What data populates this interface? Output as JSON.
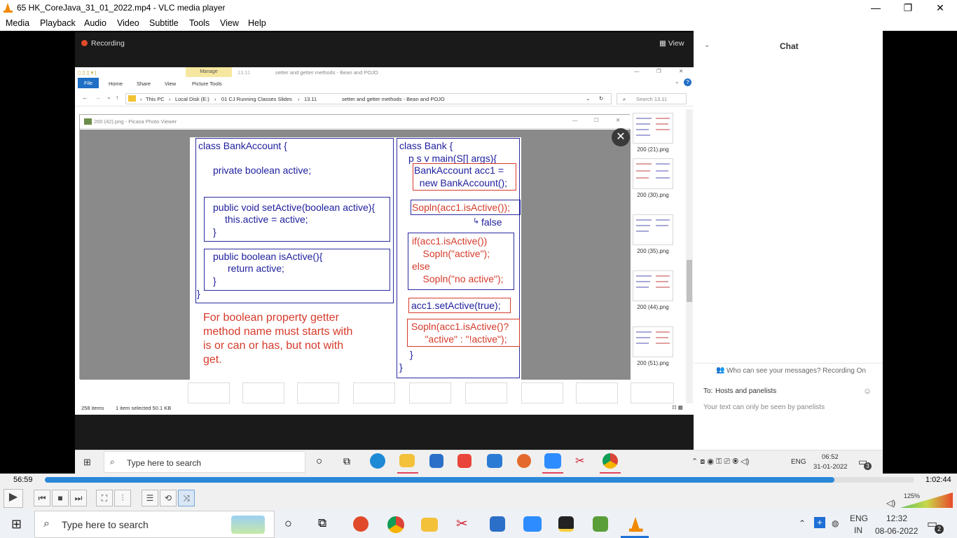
{
  "window": {
    "title": "65 HK_CoreJava_31_01_2022.mp4 - VLC media player"
  },
  "menus": [
    "Media",
    "Playback",
    "Audio",
    "Video",
    "Subtitle",
    "Tools",
    "View",
    "Help"
  ],
  "zoom": {
    "recording": "Recording",
    "view": "View"
  },
  "explorer": {
    "quick_access": "▯ ▯ ▯ ▾ |",
    "manage_tab": "Manage",
    "window_title": "13.11",
    "title_path": "setter and getter methods - Bean and POJO",
    "tabs": [
      "File",
      "Home",
      "Share",
      "View",
      "Picture Tools"
    ],
    "address": [
      "This PC",
      "Local Disk (E:)",
      "01 CJ Running Classes Slides",
      "13.11",
      "setter and getter methods - Bean and POJO"
    ],
    "search_placeholder": "Search 13.11",
    "status": {
      "items": "258 items",
      "selected": "1 item selected  50.1 KB"
    },
    "thumbs": [
      "200 (21).png",
      "200 (30).png",
      "200 (35).png",
      "200 (44).png",
      "200 (51).png"
    ]
  },
  "picasa": {
    "title": "200 (42).png - Picasa Photo Viewer"
  },
  "slide": {
    "left": {
      "l1": "class BankAccount {",
      "l2": "private boolean active;",
      "l3": "public void setActive(boolean active){",
      "l4": "this.active = active;",
      "l5": "}",
      "l6": "public boolean isActive(){",
      "l7": "return active;",
      "l8": "}",
      "l9": "}",
      "note": "For boolean property getter\nmethod name must starts with\nis or can or has, but not with\nget."
    },
    "right": {
      "r1": "class Bank {",
      "r2": "p s v main(S[] args){",
      "r3": "BankAccount acc1 =\n  new BankAccount();",
      "r4": "Sopln(acc1.isActive());",
      "r5": "false",
      "r6": "if(acc1.isActive())\n    Sopln(\"active\");\nelse\n    Sopln(\"no active\");",
      "r7": "acc1.setActive(true);",
      "r8": "Sopln(acc1.isActive()?\n     \"active\" : \"!active\");",
      "r9": "}",
      "r10": "}"
    }
  },
  "chat": {
    "title": "Chat",
    "who_can_see": "Who can see your messages? Recording On",
    "to_label": "To:",
    "to_value": "Hosts and panelists",
    "hint": "Your text can only be seen by panelists"
  },
  "inner_taskbar": {
    "search": "Type here to search",
    "lang": "ENG",
    "time": "06:52",
    "date": "31-01-2022",
    "notif": "3"
  },
  "player": {
    "elapsed": "56:59",
    "total": "1:02:44",
    "progress": 0.908,
    "volume": "125%"
  },
  "taskbar": {
    "search": "Type here to search",
    "lang1": "ENG",
    "lang2": "IN",
    "time": "12:32",
    "date": "08-06-2022",
    "notif": "2"
  }
}
